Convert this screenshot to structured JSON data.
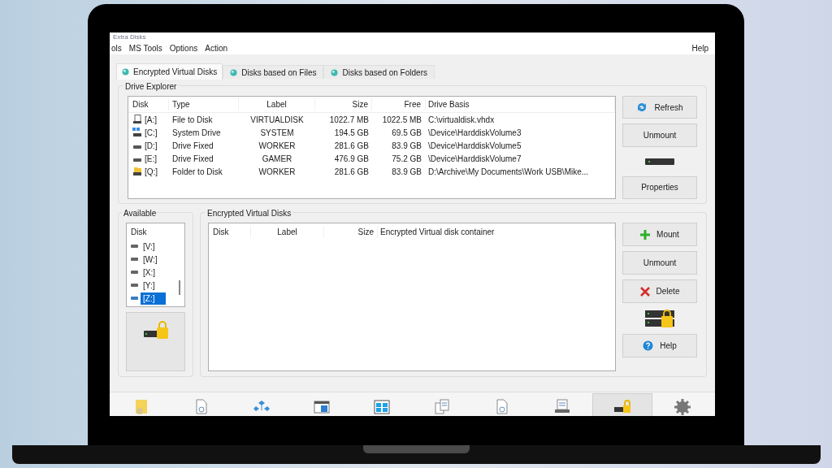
{
  "window": {
    "title": "Extra Disks"
  },
  "menu": [
    "ols",
    "MS Tools",
    "Options",
    "Action"
  ],
  "menu_right": "Help",
  "tabs": [
    {
      "label": "Encrypted Virtual Disks",
      "selected": true
    },
    {
      "label": "Disks based on Files",
      "selected": false
    },
    {
      "label": "Disks based on Folders",
      "selected": false
    }
  ],
  "drive_explorer": {
    "title": "Drive Explorer",
    "columns": [
      "Disk",
      "Type",
      "Label",
      "Size",
      "Free",
      "Drive Basis"
    ],
    "rows": [
      {
        "kind": "file",
        "disk": "[A:]",
        "type": "File to Disk",
        "label": "VIRTUALDISK",
        "size": "1022.7 MB",
        "free": "1022.5 MB",
        "basis": "C:\\virtualdisk.vhdx"
      },
      {
        "kind": "system",
        "disk": "[C:]",
        "type": "System Drive",
        "label": "SYSTEM",
        "size": "194.5 GB",
        "free": "69.5 GB",
        "basis": "\\Device\\HarddiskVolume3"
      },
      {
        "kind": "drive",
        "disk": "[D:]",
        "type": "Drive Fixed",
        "label": "WORKER",
        "size": "281.6 GB",
        "free": "83.9 GB",
        "basis": "\\Device\\HarddiskVolume5"
      },
      {
        "kind": "drive",
        "disk": "[E:]",
        "type": "Drive Fixed",
        "label": "GAMER",
        "size": "476.9 GB",
        "free": "75.2 GB",
        "basis": "\\Device\\HarddiskVolume7"
      },
      {
        "kind": "folder",
        "disk": "[Q:]",
        "type": "Folder to Disk",
        "label": "WORKER",
        "size": "281.6 GB",
        "free": "83.9 GB",
        "basis": "D:\\Archive\\My Documents\\Work USB\\Mike..."
      }
    ]
  },
  "explorer_buttons": [
    {
      "kind": "refresh",
      "label": "Refresh"
    },
    {
      "kind": "plain",
      "label": "Unmount"
    },
    {
      "kind": "drive_picture"
    },
    {
      "kind": "plain",
      "label": "Properties"
    }
  ],
  "available": {
    "title": "Available",
    "column": "Disk",
    "items": [
      {
        "label": "[V:]",
        "selected": false
      },
      {
        "label": "[W:]",
        "selected": false
      },
      {
        "label": "[X:]",
        "selected": false
      },
      {
        "label": "[Y:]",
        "selected": false
      },
      {
        "label": "[Z:]",
        "selected": true
      }
    ]
  },
  "encrypted": {
    "title": "Encrypted Virtual Disks",
    "columns": [
      "Disk",
      "Label",
      "Size",
      "Encrypted Virtual disk container"
    ]
  },
  "encrypted_buttons": [
    {
      "kind": "add",
      "label": "Mount"
    },
    {
      "kind": "plain",
      "label": "Unmount"
    },
    {
      "kind": "delete",
      "label": "Delete"
    },
    {
      "kind": "lock_picture"
    },
    {
      "kind": "help",
      "label": "Help"
    }
  ],
  "toolbar": [
    {
      "kind": "note",
      "selected": false
    },
    {
      "kind": "page",
      "selected": false
    },
    {
      "kind": "network",
      "selected": false
    },
    {
      "kind": "window",
      "selected": false
    },
    {
      "kind": "tiles",
      "selected": false
    },
    {
      "kind": "pages",
      "selected": false
    },
    {
      "kind": "page",
      "selected": false
    },
    {
      "kind": "printer",
      "selected": false
    },
    {
      "kind": "lock",
      "selected": true
    },
    {
      "kind": "gear",
      "selected": false
    }
  ]
}
